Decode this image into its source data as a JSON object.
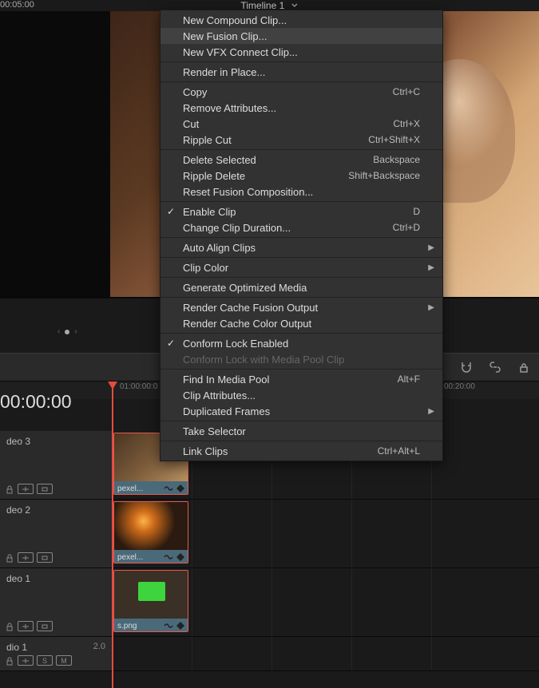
{
  "topbar": {
    "timecode": "00:05:00",
    "timeline_name": "Timeline 1"
  },
  "ruler": {
    "tc_big": "00:00:00",
    "tc1": "01:00:00:0",
    "tc2": "00:20:00"
  },
  "tracks": {
    "v3": {
      "label": "deo 3",
      "clip_name": "pexel..."
    },
    "v2": {
      "label": "deo 2",
      "clip_name": "pexel..."
    },
    "v1": {
      "label": "deo 1",
      "clip_name": "s.png"
    },
    "a1": {
      "label": "dio 1",
      "num": "2.0",
      "solo": "S",
      "mute": "M"
    }
  },
  "menu": {
    "items": [
      {
        "label": "New Compound Clip...",
        "type": "item"
      },
      {
        "label": "New Fusion Clip...",
        "type": "item",
        "highlighted": true
      },
      {
        "label": "New VFX Connect Clip...",
        "type": "item"
      },
      {
        "type": "sep"
      },
      {
        "label": "Render in Place...",
        "type": "item"
      },
      {
        "type": "sep"
      },
      {
        "label": "Copy",
        "shortcut": "Ctrl+C",
        "type": "item"
      },
      {
        "label": "Remove Attributes...",
        "type": "item"
      },
      {
        "label": "Cut",
        "shortcut": "Ctrl+X",
        "type": "item"
      },
      {
        "label": "Ripple Cut",
        "shortcut": "Ctrl+Shift+X",
        "type": "item"
      },
      {
        "type": "sep"
      },
      {
        "label": "Delete Selected",
        "shortcut": "Backspace",
        "type": "item"
      },
      {
        "label": "Ripple Delete",
        "shortcut": "Shift+Backspace",
        "type": "item"
      },
      {
        "label": "Reset Fusion Composition...",
        "type": "item"
      },
      {
        "type": "sep"
      },
      {
        "label": "Enable Clip",
        "shortcut": "D",
        "type": "item",
        "check": true
      },
      {
        "label": "Change Clip Duration...",
        "shortcut": "Ctrl+D",
        "type": "item"
      },
      {
        "type": "sep"
      },
      {
        "label": "Auto Align Clips",
        "type": "item",
        "submenu": true
      },
      {
        "type": "sep"
      },
      {
        "label": "Clip Color",
        "type": "item",
        "submenu": true
      },
      {
        "type": "sep"
      },
      {
        "label": "Generate Optimized Media",
        "type": "item"
      },
      {
        "type": "sep"
      },
      {
        "label": "Render Cache Fusion Output",
        "type": "item",
        "submenu": true
      },
      {
        "label": "Render Cache Color Output",
        "type": "item"
      },
      {
        "type": "sep"
      },
      {
        "label": "Conform Lock Enabled",
        "type": "item",
        "check": true
      },
      {
        "label": "Conform Lock with Media Pool Clip",
        "type": "item",
        "disabled": true
      },
      {
        "type": "sep"
      },
      {
        "label": "Find In Media Pool",
        "shortcut": "Alt+F",
        "type": "item"
      },
      {
        "label": "Clip Attributes...",
        "type": "item"
      },
      {
        "label": "Duplicated Frames",
        "type": "item",
        "submenu": true
      },
      {
        "type": "sep"
      },
      {
        "label": "Take Selector",
        "type": "item"
      },
      {
        "type": "sep"
      },
      {
        "label": "Link Clips",
        "shortcut": "Ctrl+Alt+L",
        "type": "item"
      }
    ]
  }
}
